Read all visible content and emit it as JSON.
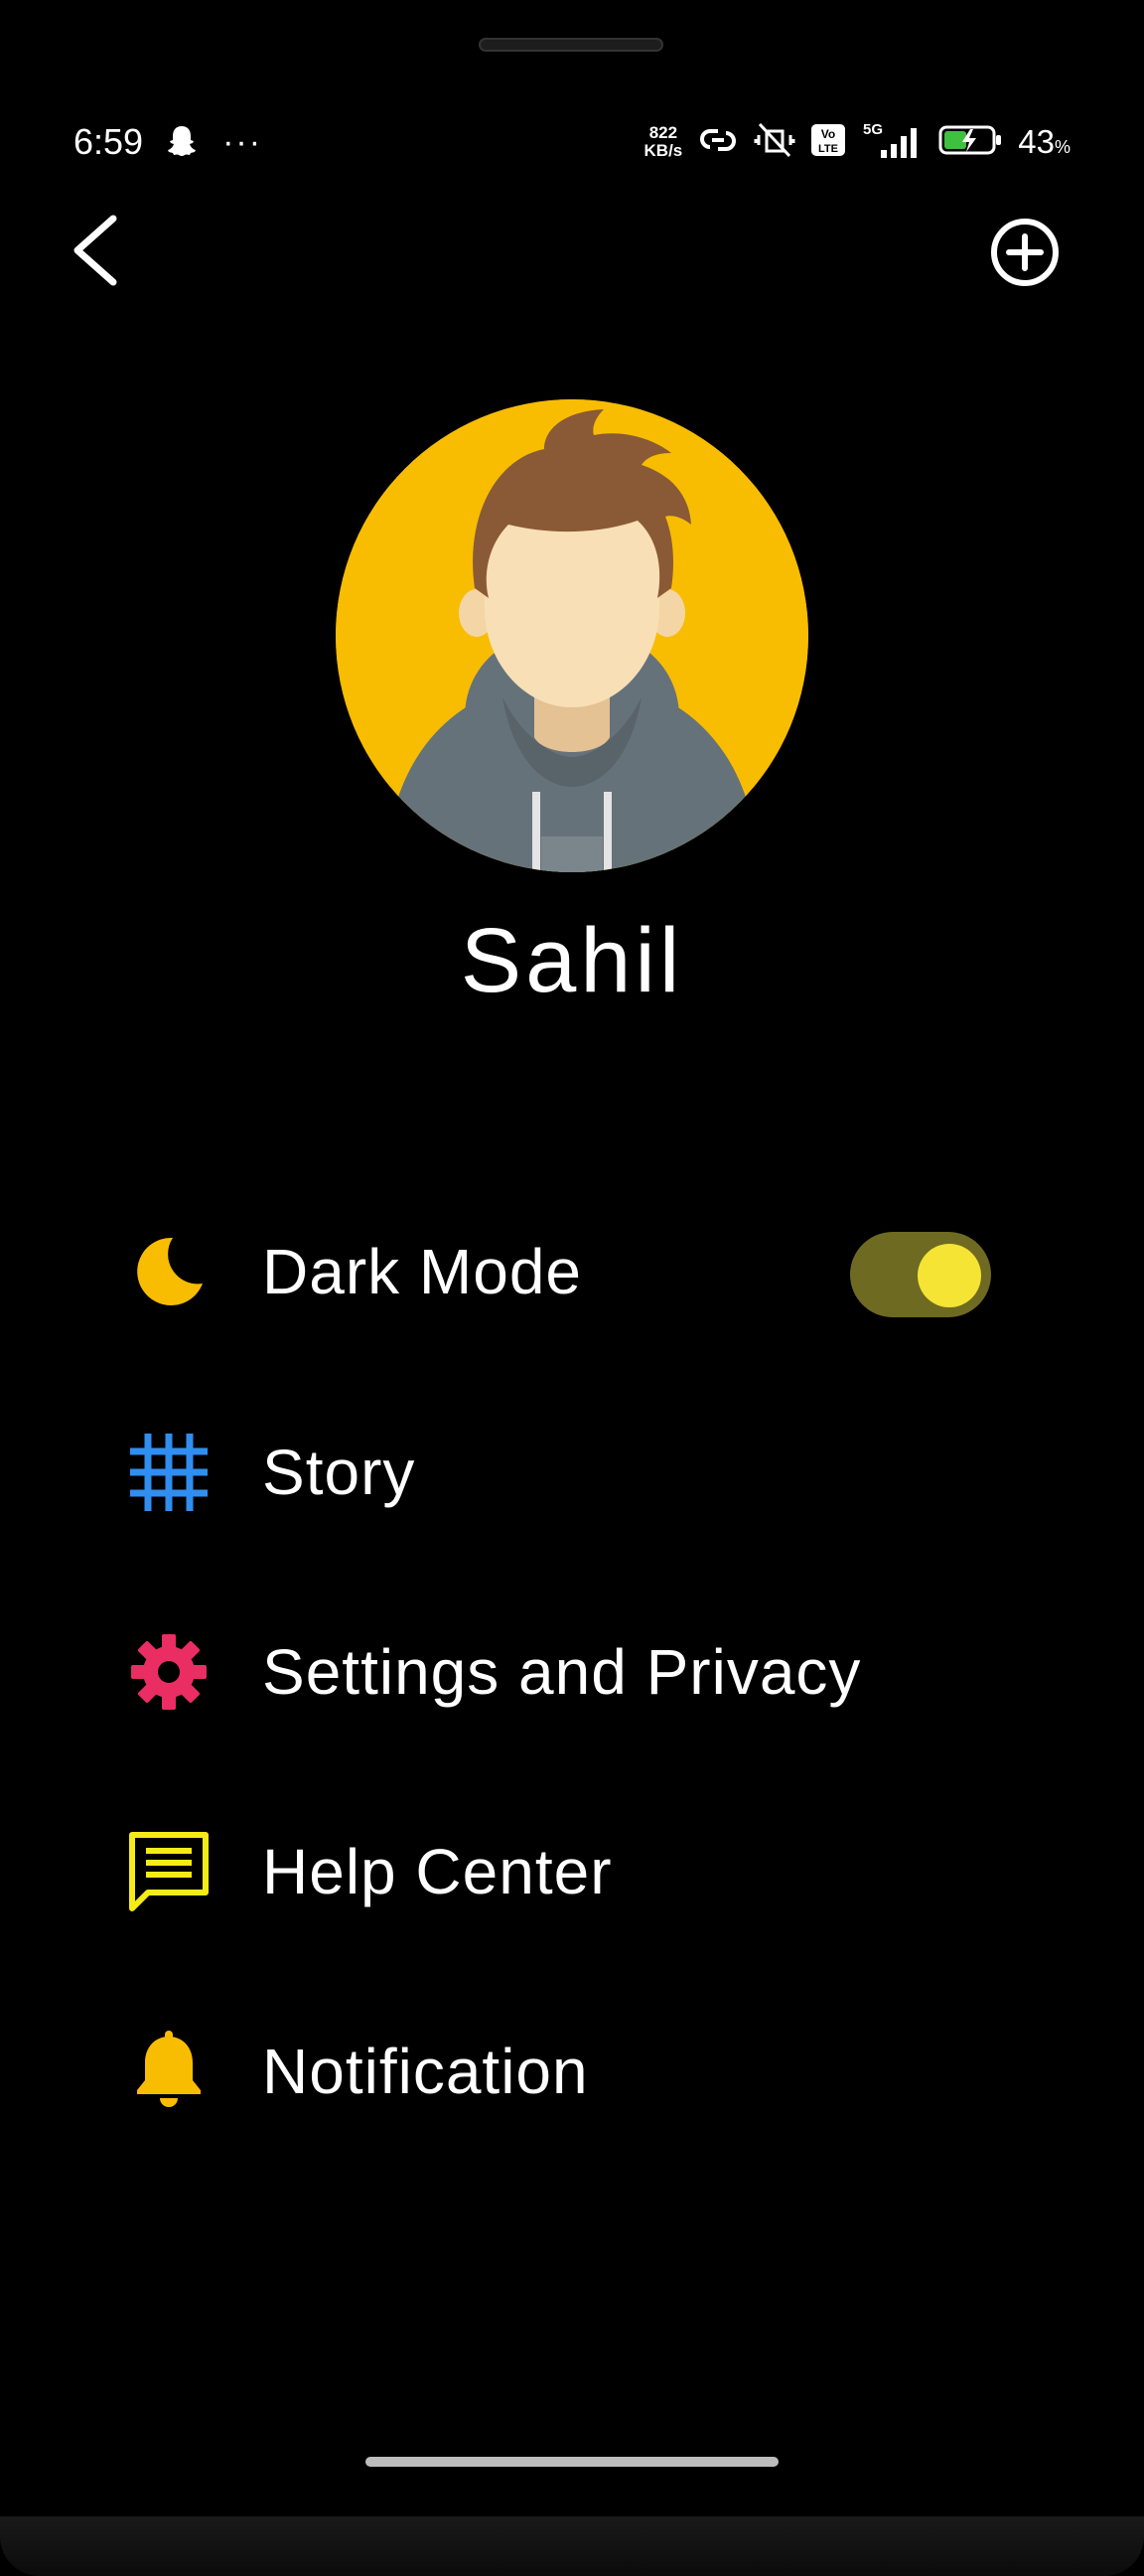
{
  "status_bar": {
    "time": "6:59",
    "more": "···",
    "net_speed_value": "822",
    "net_speed_unit": "KB/s",
    "network": "5G",
    "volte": "Vo LTE",
    "battery_percent": "43",
    "battery_unit": "%"
  },
  "profile": {
    "name": "Sahil"
  },
  "menu": [
    {
      "label": "Dark Mode",
      "icon": "moon-icon",
      "color": "#f8bd00"
    },
    {
      "label": "Story",
      "icon": "grid-icon",
      "color": "#2f8ef0"
    },
    {
      "label": "Settings and Privacy",
      "icon": "gear-icon",
      "color": "#ea2d63"
    },
    {
      "label": "Help Center",
      "icon": "chat-lines-icon",
      "color": "#f5eb16"
    },
    {
      "label": "Notification",
      "icon": "bell-icon",
      "color": "#f8bd00"
    }
  ],
  "dark_mode_enabled": true,
  "colors": {
    "background": "#000000",
    "accent_yellow": "#f8bd00",
    "toggle_track": "#6f6a21",
    "toggle_knob": "#f5e433"
  }
}
